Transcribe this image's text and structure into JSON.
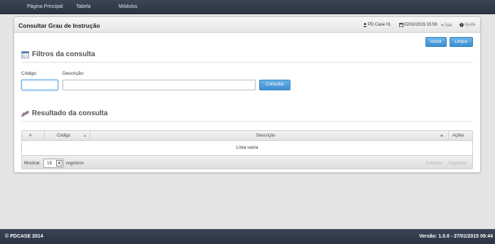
{
  "nav": {
    "items": [
      {
        "label": "Página Principal"
      },
      {
        "label": "Tabela"
      },
      {
        "label": "Módulos"
      }
    ]
  },
  "panel": {
    "title": "Consultar Grau de Instrução",
    "user": "PD Case 01",
    "datetime": "02/02/2015 15:56",
    "logout": "Sair",
    "help": "Ajuda"
  },
  "actions": {
    "include": "Incluir",
    "clear": "Limpar"
  },
  "filters": {
    "title": "Filtros da consulta",
    "code_label": "Código:",
    "code_value": "",
    "desc_label": "Descrição:",
    "desc_value": "",
    "search_button": "Consultar"
  },
  "results": {
    "title": "Resultado da consulta",
    "columns": [
      "#",
      "Código",
      "Descrição",
      "Ações"
    ],
    "empty_text": "Lista vazia",
    "show_label": "Mostrar",
    "page_size": "15",
    "records_label": "registros",
    "prev": "Anterior",
    "next": "Seguinte"
  },
  "footer": {
    "copyright": "© PDCASE 2014",
    "version": "Versão: 1.0.0 - 27/01/2015 09:44"
  },
  "colors": {
    "navbar": "#2f3a48",
    "primary_button": "#4a9ad9",
    "background": "#e4e4e4"
  }
}
